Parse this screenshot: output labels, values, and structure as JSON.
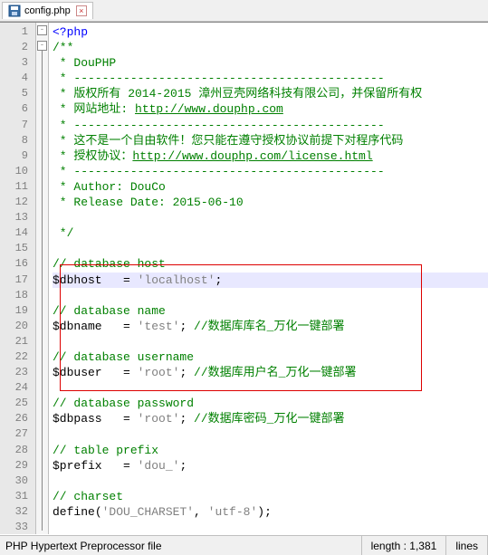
{
  "tab": {
    "filename": "config.php",
    "close_glyph": "×"
  },
  "code": {
    "lines": [
      {
        "n": 1,
        "html": "<span class='kw'>&lt;?php</span>"
      },
      {
        "n": 2,
        "html": "<span class='comment'>/**</span>"
      },
      {
        "n": 3,
        "html": "<span class='comment'> * DouPHP</span>"
      },
      {
        "n": 4,
        "html": "<span class='comment'> * --------------------------------------------</span>"
      },
      {
        "n": 5,
        "html": "<span class='comment'> * 版权所有 2014-2015 漳州豆壳网络科技有限公司，并保留所有权</span>"
      },
      {
        "n": 6,
        "html": "<span class='comment'> * 网站地址: </span><span class='link'>http://www.douphp.com</span>"
      },
      {
        "n": 7,
        "html": "<span class='comment'> * --------------------------------------------</span>"
      },
      {
        "n": 8,
        "html": "<span class='comment'> * 这不是一个自由软件！您只能在遵守授权协议前提下对程序代码</span>"
      },
      {
        "n": 9,
        "html": "<span class='comment'> * 授权协议：</span><span class='link'>http://www.douphp.com/license.html</span>"
      },
      {
        "n": 10,
        "html": "<span class='comment'> * --------------------------------------------</span>"
      },
      {
        "n": 11,
        "html": "<span class='comment'> * Author: DouCo</span>"
      },
      {
        "n": 12,
        "html": "<span class='comment'> * Release Date: 2015-06-10</span>"
      },
      {
        "n": 13,
        "html": ""
      },
      {
        "n": 14,
        "html": "<span class='comment'> */</span>"
      },
      {
        "n": 15,
        "html": ""
      },
      {
        "n": 16,
        "html": "<span class='comment'>// database host</span>"
      },
      {
        "n": 17,
        "html": "<span class='var'>$dbhost   = </span><span class='str'>'localhost'</span><span class='var'>;</span>",
        "hl": true
      },
      {
        "n": 18,
        "html": ""
      },
      {
        "n": 19,
        "html": "<span class='comment'>// database name</span>"
      },
      {
        "n": 20,
        "html": "<span class='var'>$dbname   = </span><span class='str'>'test'</span><span class='var'>; </span><span class='comment'>//数据库库名_万化一键部署</span>"
      },
      {
        "n": 21,
        "html": ""
      },
      {
        "n": 22,
        "html": "<span class='comment'>// database username</span>"
      },
      {
        "n": 23,
        "html": "<span class='var'>$dbuser   = </span><span class='str'>'root'</span><span class='var'>; </span><span class='comment'>//数据库用户名_万化一键部署</span>"
      },
      {
        "n": 24,
        "html": ""
      },
      {
        "n": 25,
        "html": "<span class='comment'>// database password</span>"
      },
      {
        "n": 26,
        "html": "<span class='var'>$dbpass   = </span><span class='str'>'root'</span><span class='var'>; </span><span class='comment'>//数据库密码_万化一键部署</span>"
      },
      {
        "n": 27,
        "html": ""
      },
      {
        "n": 28,
        "html": "<span class='comment'>// table prefix</span>"
      },
      {
        "n": 29,
        "html": "<span class='var'>$prefix   = </span><span class='str'>'dou_'</span><span class='var'>;</span>"
      },
      {
        "n": 30,
        "html": ""
      },
      {
        "n": 31,
        "html": "<span class='comment'>// charset</span>"
      },
      {
        "n": 32,
        "html": "<span class='func'>define</span><span class='var'>(</span><span class='str'>'DOU_CHARSET'</span><span class='var'>, </span><span class='str'>'utf-8'</span><span class='var'>);</span>"
      },
      {
        "n": 33,
        "html": ""
      }
    ]
  },
  "status": {
    "filetype": "PHP Hypertext Preprocessor file",
    "length_label": "length : 1,381",
    "lines_label": "lines"
  }
}
